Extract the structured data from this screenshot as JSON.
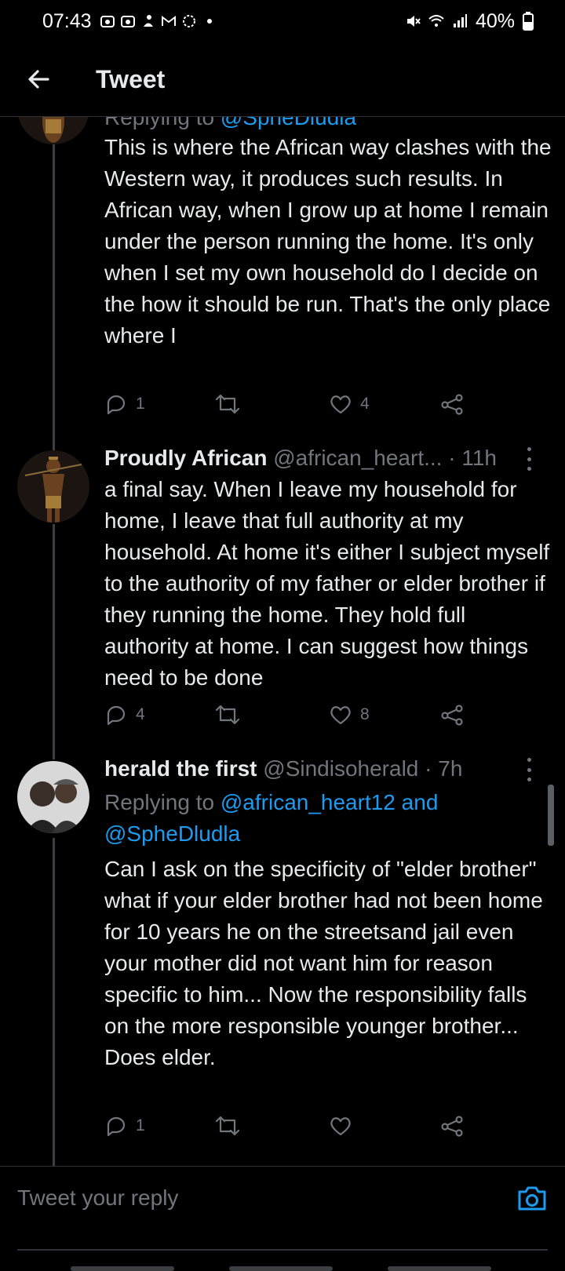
{
  "status": {
    "time": "07:43",
    "battery": "40%"
  },
  "header": {
    "title": "Tweet"
  },
  "tweets": [
    {
      "replying_prefix": "Replying to ",
      "replying_to": "@SpheDludla",
      "text": "This is where the African way clashes with the Western way, it produces such results. In African way, when I grow up at home I remain under the person running the home. It's only when I set my own household do I decide on the how it should be run. That's the only place where I",
      "replies": "1",
      "retweets": "",
      "likes": "4"
    },
    {
      "name": "Proudly African",
      "handle": "@african_heart...",
      "time": "· 11h",
      "text": "a final say. When I leave my household for home, I leave that full authority at my household. At home it's either I subject myself to the authority of my father or elder brother if they running the home. They hold full authority at home. I can suggest how things need to be done",
      "replies": "4",
      "retweets": "",
      "likes": "8"
    },
    {
      "name": "herald the first",
      "handle": "@Sindisoherald",
      "time": "· 7h",
      "replying_prefix": "Replying to ",
      "replying_to_1": "@african_heart12",
      "replying_and": " and",
      "replying_to_2": "@SpheDludla",
      "text": "Can I ask on the specificity of \"elder brother\" what if your elder brother had not been home for 10 years he on the streetsand jail  even your mother did not want him for reason specific to him... Now the responsibility falls on the more responsible younger brother... Does elder.",
      "replies": "1",
      "retweets": "",
      "likes": ""
    }
  ],
  "reply_box": {
    "placeholder": "Tweet your reply"
  },
  "colors": {
    "background": "#000000",
    "text": "#e7e9ea",
    "secondary": "#71767b",
    "accent": "#1d9bf0"
  }
}
